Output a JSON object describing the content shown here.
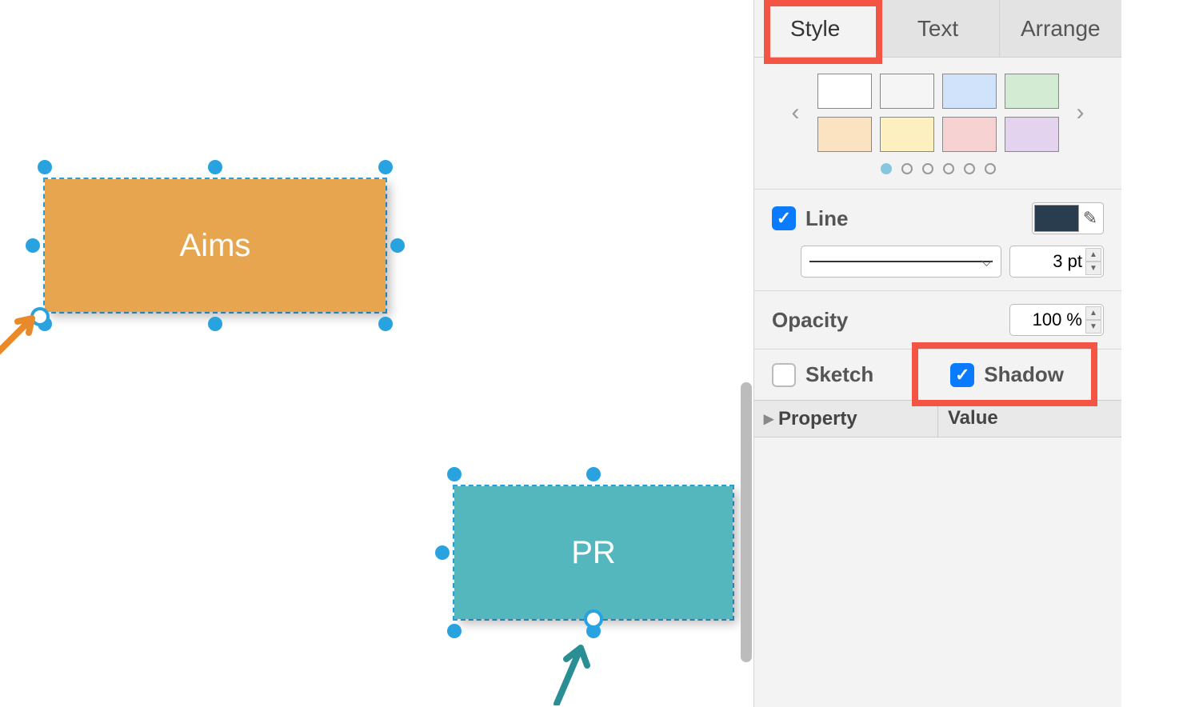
{
  "tabs": {
    "style": "Style",
    "text": "Text",
    "arrange": "Arrange"
  },
  "swatches": [
    "#ffffff",
    "#f5f5f5",
    "#d0e3fa",
    "#d3ebd3",
    "#fbe3c2",
    "#fcf0c0",
    "#f6d2d2",
    "#e3d3ee"
  ],
  "line": {
    "label": "Line",
    "checked": true,
    "color": "#2a3d4f",
    "width": "3 pt"
  },
  "opacity": {
    "label": "Opacity",
    "value": "100 %"
  },
  "sketch": {
    "label": "Sketch",
    "checked": false
  },
  "shadow": {
    "label": "Shadow",
    "checked": true
  },
  "table": {
    "prop": "Property",
    "val": "Value"
  },
  "shapes": {
    "aims": {
      "label": "Aims",
      "fill": "#e8a54f"
    },
    "pr": {
      "label": "PR",
      "fill": "#54b7bd"
    }
  }
}
